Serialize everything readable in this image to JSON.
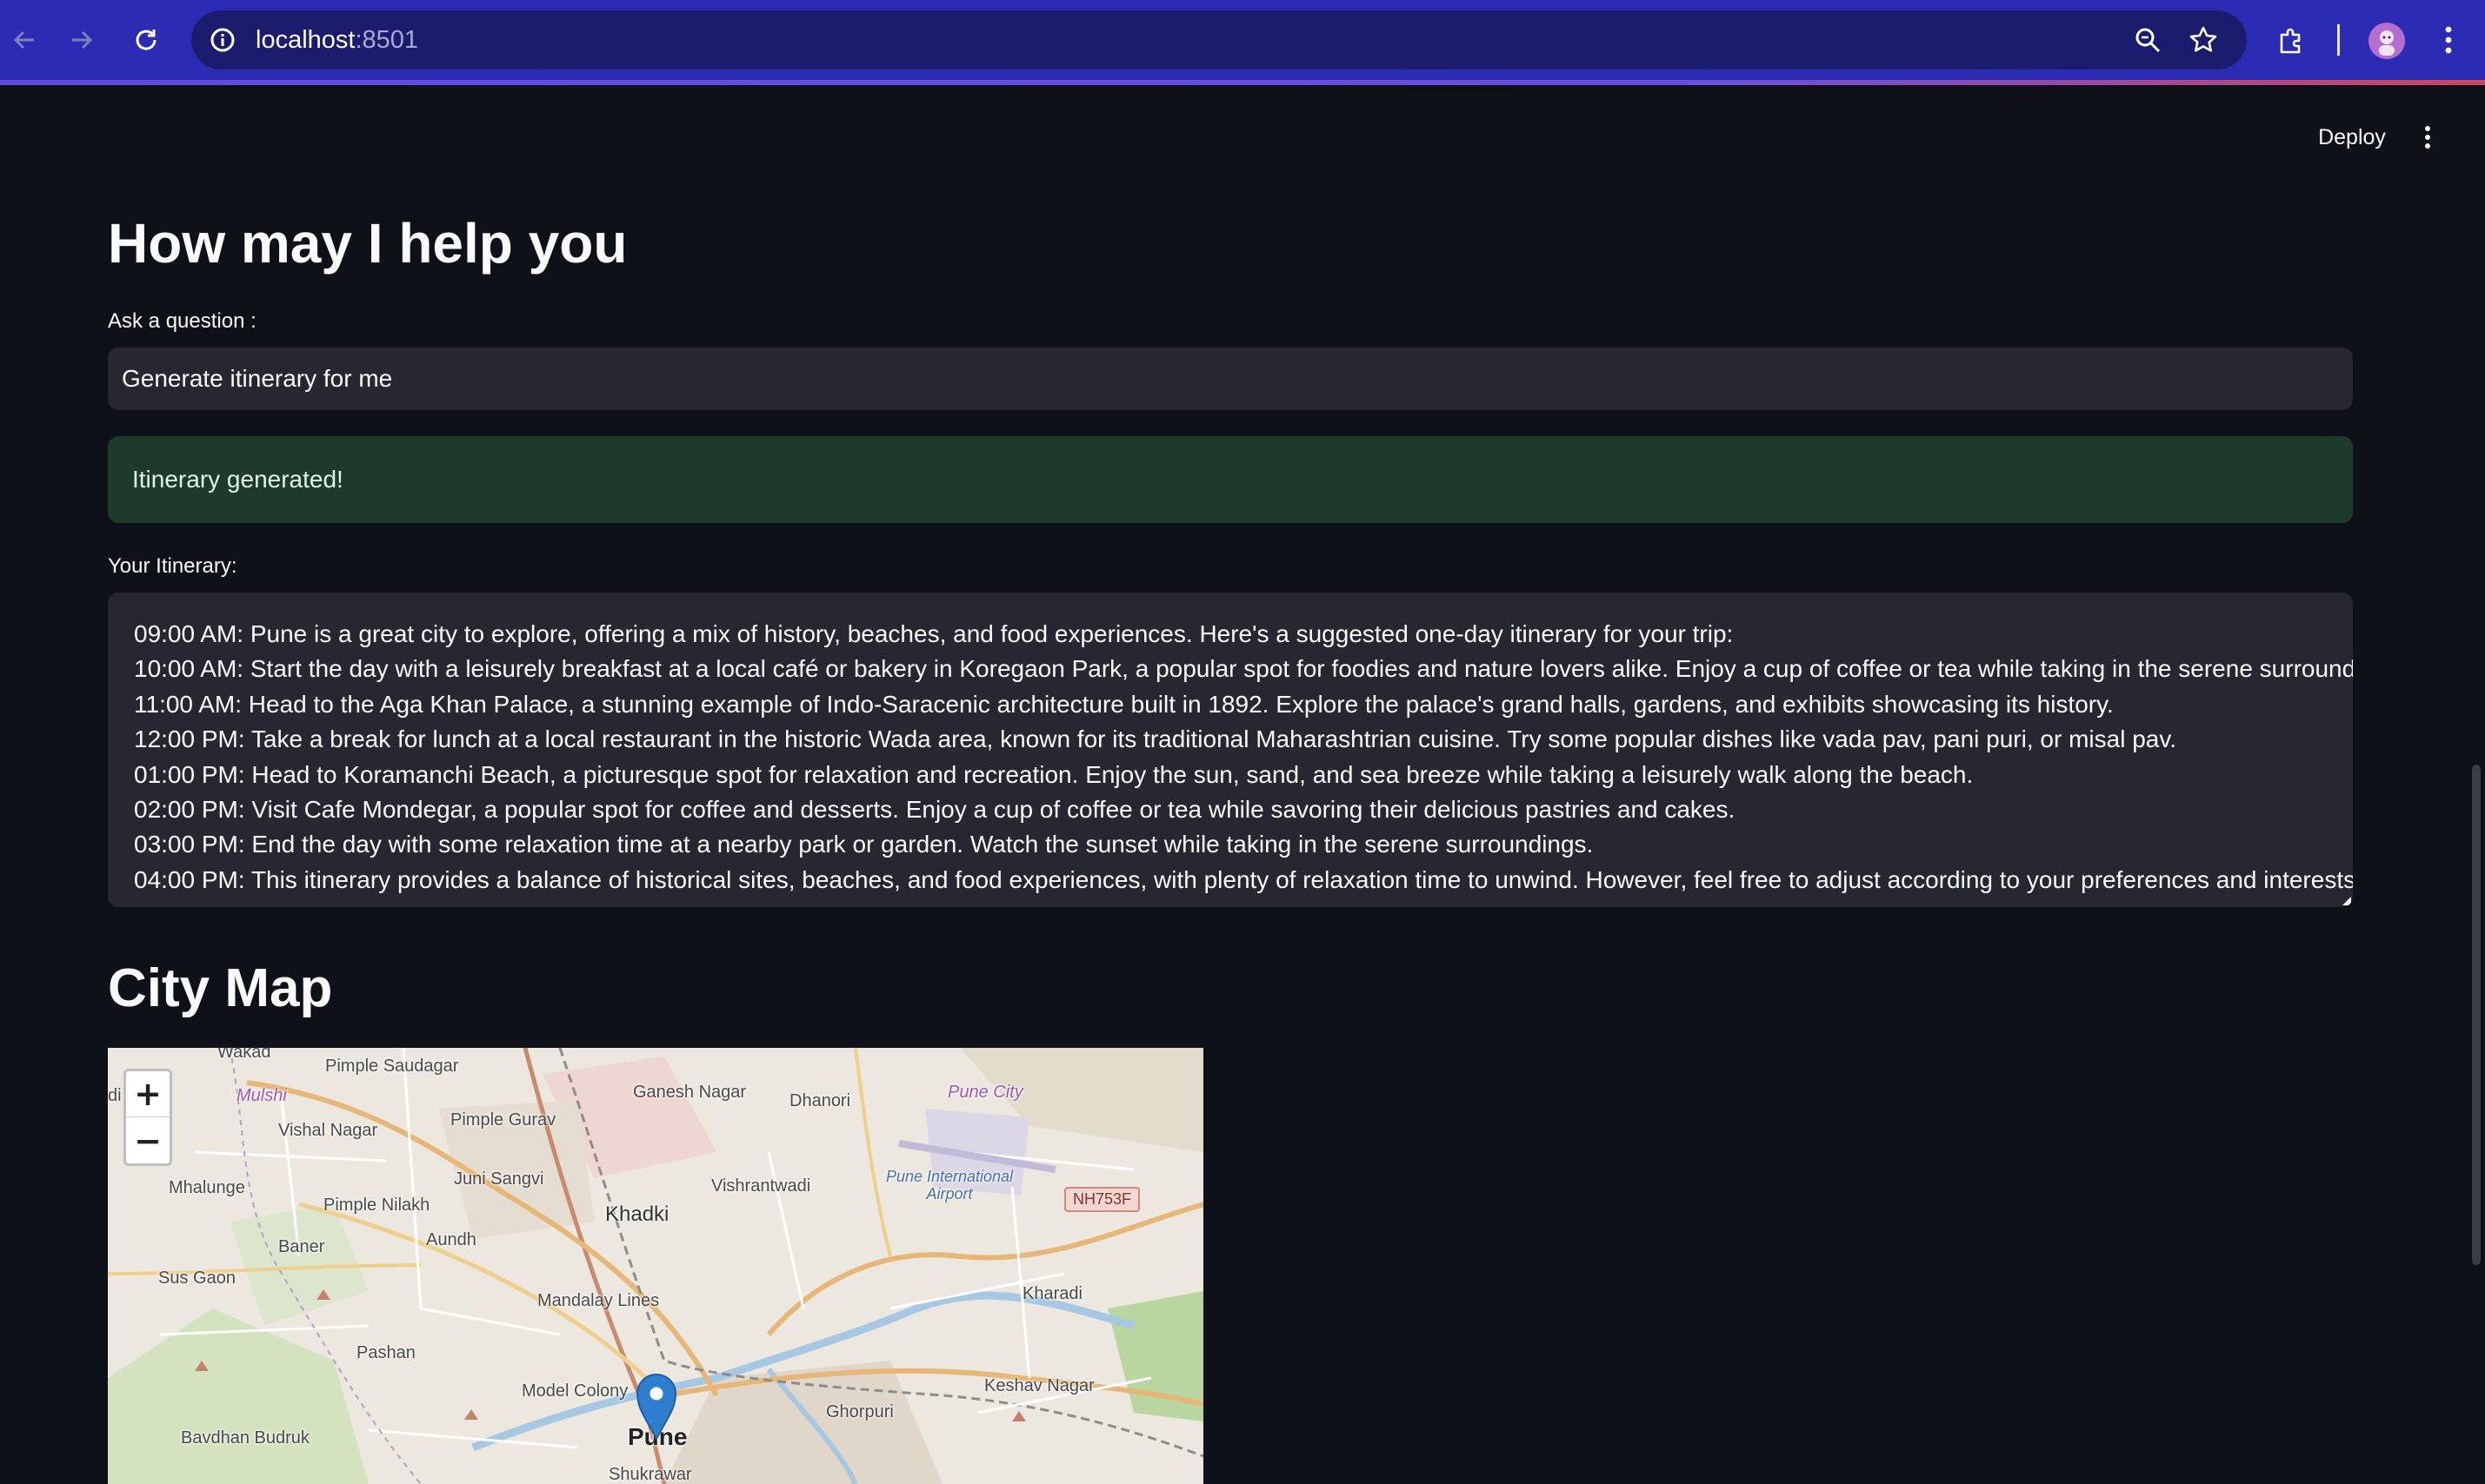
{
  "browser": {
    "url_host": "localhost",
    "url_port": ":8501"
  },
  "toolbar": {
    "deploy_label": "Deploy"
  },
  "main": {
    "title": "How may I help you",
    "question_label": "Ask a question :",
    "question_value": "Generate itinerary for me",
    "success_message": "Itinerary generated!",
    "itinerary_label": "Your Itinerary:",
    "itinerary_lines": [
      "09:00 AM: Pune is a great city to explore, offering a mix of history, beaches, and food experiences. Here's a suggested one-day itinerary for your trip:",
      "10:00 AM: Start the day with a leisurely breakfast at a local café or bakery in Koregaon Park, a popular spot for foodies and nature lovers alike. Enjoy a cup of coffee or tea while taking in the serene surroundings.",
      "11:00 AM: Head to the Aga Khan Palace, a stunning example of Indo-Saracenic architecture built in 1892. Explore the palace's grand halls, gardens, and exhibits showcasing its history.",
      "12:00 PM: Take a break for lunch at a local restaurant in the historic Wada area, known for its traditional Maharashtrian cuisine. Try some popular dishes like vada pav, pani puri, or misal pav.",
      "01:00 PM: Head to Koramanchi Beach, a picturesque spot for relaxation and recreation. Enjoy the sun, sand, and sea breeze while taking a leisurely walk along the beach.",
      "02:00 PM: Visit Cafe Mondegar, a popular spot for coffee and desserts. Enjoy a cup of coffee or tea while savoring their delicious pastries and cakes.",
      "03:00 PM: End the day with some relaxation time at a nearby park or garden. Watch the sunset while taking in the serene surroundings.",
      "04:00 PM: This itinerary provides a balance of historical sites, beaches, and food experiences, with plenty of relaxation time to unwind. However, feel free to adjust according to your preferences and interests!"
    ],
    "map_heading": "City Map"
  },
  "map": {
    "zoom_in": "+",
    "zoom_out": "−",
    "road_shield": "NH753F",
    "labels": {
      "wakad": "Wakad",
      "pimple_saudagar": "Pimple Saudagar",
      "ganesh_nagar": "Ganesh Nagar",
      "dhanori": "Dhanori",
      "pune_city": "Pune City",
      "mulshi": "Mulshi",
      "pimple_gurav": "Pimple Gurav",
      "vishal_nagar": "Vishal Nagar",
      "juni_sangvi": "Juni Sangvi",
      "vishrantwadi": "Vishrantwadi",
      "airport": "Pune International Airport",
      "mhalunge": "Mhalunge",
      "pimple_nilakh": "Pimple Nilakh",
      "khadki": "Khadki",
      "baner": "Baner",
      "aundh": "Aundh",
      "sus_gaon": "Sus Gaon",
      "kharadi": "Kharadi",
      "mandalay_lines": "Mandalay Lines",
      "pashan": "Pashan",
      "model_colony": "Model Colony",
      "keshav_nagar": "Keshav Nagar",
      "ghorpuri": "Ghorpuri",
      "pune": "Pune",
      "bavdhan_budruk": "Bavdhan Budruk",
      "shukrawar": "Shukrawar",
      "di": "di"
    }
  },
  "colors": {
    "app_background": "#0e1117",
    "input_background": "#262730",
    "success_background": "#1e3a2a",
    "browser_frame": "#2b2bb3",
    "marker_blue": "#2f7fd0"
  },
  "icons": [
    "back-arrow-icon",
    "forward-arrow-icon",
    "reload-icon",
    "site-info-icon",
    "zoom-icon",
    "bookmark-star-icon",
    "extensions-icon",
    "profile-avatar-icon",
    "browser-menu-icon",
    "kebab-menu-icon",
    "map-marker-icon"
  ]
}
